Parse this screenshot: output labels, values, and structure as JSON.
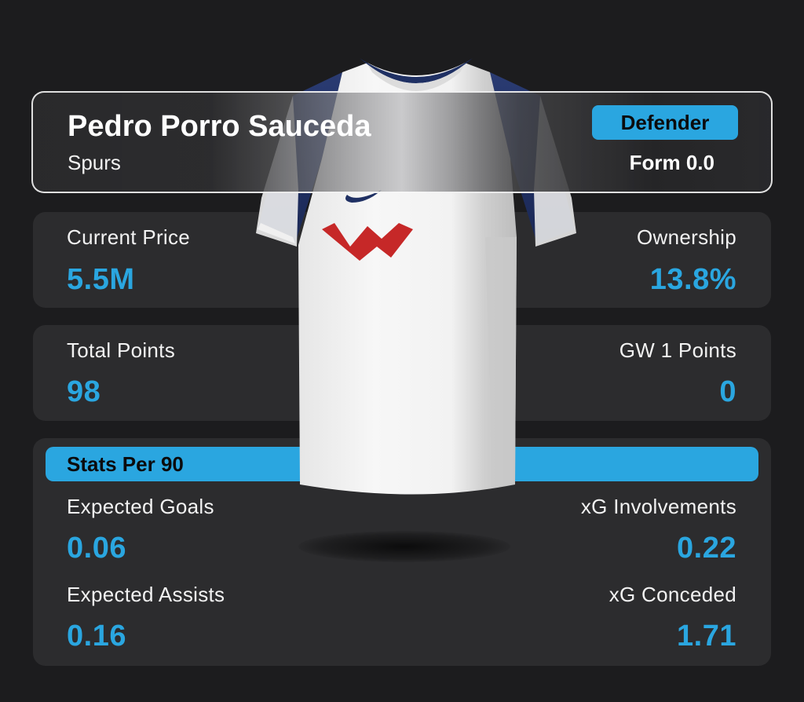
{
  "player": {
    "name": "Pedro Porro Sauceda",
    "team": "Spurs",
    "position": "Defender",
    "form": "Form 0.0"
  },
  "price": {
    "label": "Current Price",
    "value": "5.5M"
  },
  "ownership": {
    "label": "Ownership",
    "value": "13.8%"
  },
  "total_points": {
    "label": "Total Points",
    "value": "98"
  },
  "gw_points": {
    "label": "GW 1 Points",
    "value": "0"
  },
  "stats": {
    "title": "Stats Per 90",
    "expected_goals": {
      "label": "Expected Goals",
      "value": "0.06"
    },
    "xg_involvements": {
      "label": "xG Involvements",
      "value": "0.22"
    },
    "expected_assists": {
      "label": "Expected Assists",
      "value": "0.16"
    },
    "xg_conceded": {
      "label": "xG Conceded",
      "value": "1.71"
    }
  },
  "colors": {
    "background": "#1c1c1e",
    "card": "#2c2c2e",
    "accent": "#2aa6e0",
    "shirt_sleeve": "#1f3063",
    "shirt_logo": "#d32f2f"
  }
}
